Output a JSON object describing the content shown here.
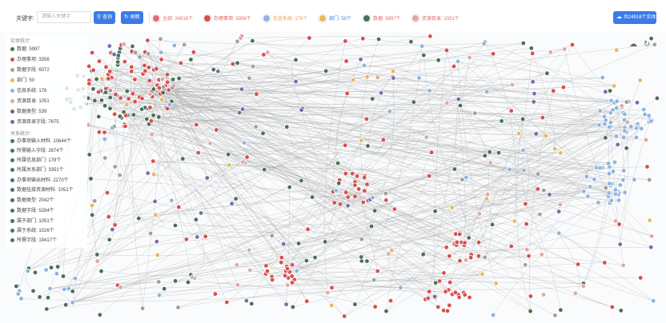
{
  "toolbar": {
    "keyword_label": "关键字:",
    "search_placeholder": "请输入关键字",
    "query_label": "查询",
    "refresh_label": "刷新",
    "total_entities_label": "共24916个实体"
  },
  "stats": [
    {
      "label": "全部: 24916个",
      "color": "#e86a6a",
      "text_color": "#e86a6a"
    },
    {
      "label": "办理事项: 3356个",
      "color": "#d94f4f",
      "text_color": "#e06262"
    },
    {
      "label": "信息系统: 176个",
      "color": "#8fb4dd",
      "text_color": "#e8a057"
    },
    {
      "label": "部门: 50个",
      "color": "#e8b85e",
      "text_color": "#4a7fd4"
    },
    {
      "label": "数据: 5997个",
      "color": "#4a7058",
      "text_color": "#e86a6a"
    },
    {
      "label": "资源目录: 1051个",
      "color": "#e0a9a0",
      "text_color": "#e86a6a"
    }
  ],
  "entity_panel": {
    "title": "实体统计:",
    "rows": [
      {
        "label": "数据: 5997",
        "color": "#4a7058"
      },
      {
        "label": "办理事项: 3356",
        "color": "#d94f4f"
      },
      {
        "label": "数据字段: 6072",
        "color": "#a0a0a0"
      },
      {
        "label": "部门: 50",
        "color": "#e8b85e"
      },
      {
        "label": "信息系统: 176",
        "color": "#8fb4dd"
      },
      {
        "label": "资源目录: 1051",
        "color": "#e0a9a0"
      },
      {
        "label": "数据类型: 539",
        "color": "#6b6b6b"
      },
      {
        "label": "资源目录字段: 7675",
        "color": "#7c6aa8"
      }
    ]
  },
  "relation_panel": {
    "title": "关系统计:",
    "rows": [
      {
        "label": "办事项输入材料: 10644个",
        "color": "#4a7070"
      },
      {
        "label": "所需输入字段: 2674个",
        "color": "#4a7070"
      },
      {
        "label": "所属信息部门: 178个",
        "color": "#4a7070"
      },
      {
        "label": "所属关系部门: 3351个",
        "color": "#4a7070"
      },
      {
        "label": "办事项输出材料: 2270个",
        "color": "#4a7070"
      },
      {
        "label": "数据挂接资源材料: 1051个",
        "color": "#4a7070"
      },
      {
        "label": "数据类型: 2042个",
        "color": "#4a7070"
      },
      {
        "label": "数据字段: 5284个",
        "color": "#4a7070"
      },
      {
        "label": "属于部门: 1051个",
        "color": "#4a7070"
      },
      {
        "label": "属于系统: 1026个",
        "color": "#4a7070"
      },
      {
        "label": "所需字段: 19417个",
        "color": "#4a7070"
      }
    ]
  },
  "colors": {
    "accent": "#3a7be8",
    "edge": "#9a9a9a"
  },
  "icons": {
    "search": "search-icon",
    "refresh": "refresh-icon",
    "total": "cloud-download-icon",
    "canvas_download": "download-icon",
    "canvas_reset": "reset-icon"
  }
}
